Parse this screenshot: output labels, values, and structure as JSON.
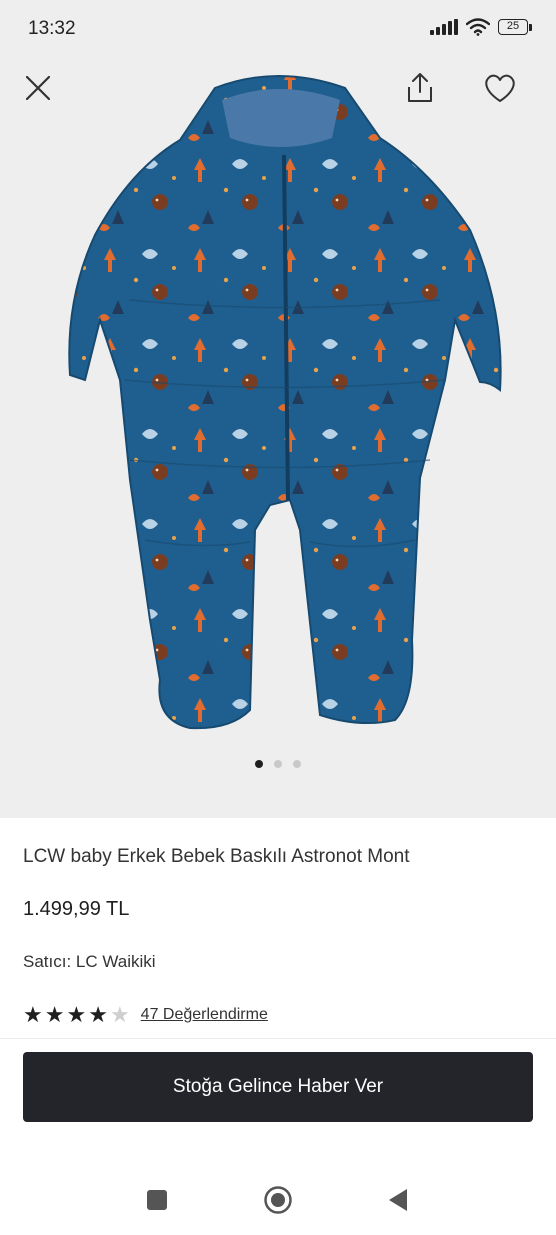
{
  "status": {
    "time": "13:32",
    "battery": "25",
    "icons": [
      "signal-icon",
      "wifi-icon",
      "battery-icon"
    ]
  },
  "toolbar": {
    "icons": [
      "close-icon",
      "share-icon",
      "heart-icon"
    ]
  },
  "gallery": {
    "image": "blue woodland animal print baby snowsuit",
    "pages": 3,
    "active_page": 1
  },
  "product": {
    "title": "LCW baby Erkek Bebek Baskılı Astronot Mont",
    "price": "1.499,99 TL",
    "seller": "Satıcı: LC Waikiki",
    "rating": 4,
    "rating_max": 5,
    "reviews": "47 Değerlendirme"
  },
  "cta": {
    "label": "Stoğa Gelince Haber Ver"
  },
  "navigation": {
    "icons": [
      "recent-apps-icon",
      "home-icon",
      "back-icon"
    ]
  },
  "colors": {
    "suit_blue": "#1f5f8f",
    "accent_orange": "#d4692e",
    "button_dark": "#23252a"
  }
}
